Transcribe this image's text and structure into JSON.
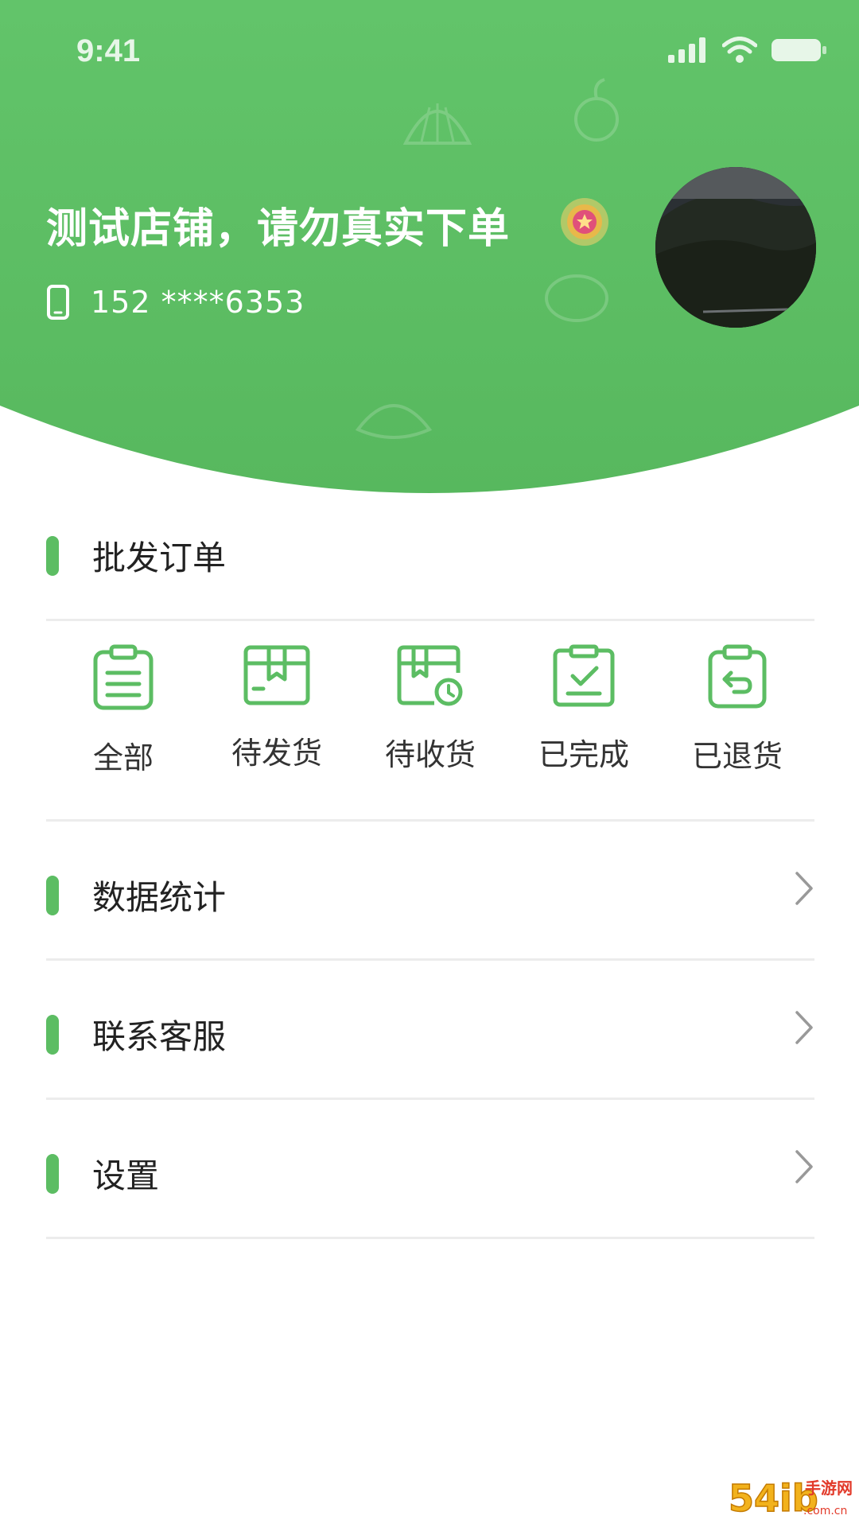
{
  "status_bar": {
    "time": "9:41"
  },
  "profile": {
    "shop_name": "测试店铺，请勿真实下单",
    "phone": "152 ****6353"
  },
  "orders": {
    "title": "批发订单",
    "items": [
      {
        "label": "全部",
        "icon": "clipboard-list-icon"
      },
      {
        "label": "待发货",
        "icon": "package-box-icon"
      },
      {
        "label": "待收货",
        "icon": "delivery-clock-icon"
      },
      {
        "label": "已完成",
        "icon": "clipboard-check-icon"
      },
      {
        "label": "已退货",
        "icon": "clipboard-return-icon"
      }
    ]
  },
  "menu": {
    "items": [
      {
        "label": "数据统计"
      },
      {
        "label": "联系客服"
      },
      {
        "label": "设置"
      }
    ]
  },
  "watermark": {
    "text_main": "54ib",
    "text_cn": "手游网",
    "text_domain": ".com.cn"
  },
  "colors": {
    "accent": "#5cbd63",
    "header": "#5cbd63",
    "text": "#222222",
    "divider": "#ececec"
  }
}
